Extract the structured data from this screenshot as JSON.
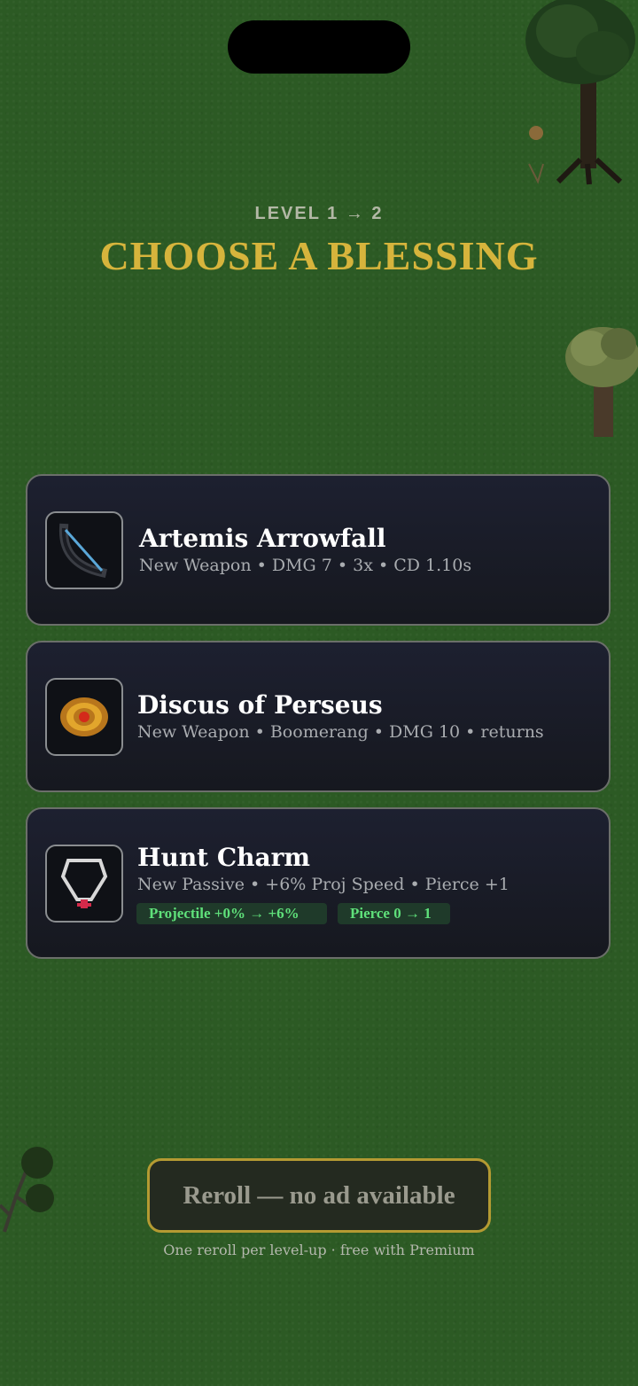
{
  "header": {
    "level_label": "LEVEL 1 → 2",
    "title": "CHOOSE A BLESSING"
  },
  "blessings": [
    {
      "icon": "bow-icon",
      "title": "Artemis Arrowfall",
      "description": "New Weapon • DMG 7 • 3x • CD 1.10s"
    },
    {
      "icon": "discus-icon",
      "title": "Discus of Perseus",
      "description": "New Weapon • Boomerang • DMG 10 • returns"
    },
    {
      "icon": "charm-necklace-icon",
      "title": "Hunt Charm",
      "description": "New Passive • +6% Proj Speed • Pierce +1",
      "chips": [
        "Projectile +0% → +6%",
        "Pierce 0 → 1"
      ]
    }
  ],
  "reroll": {
    "button_label": "Reroll — no ad available",
    "note": "One reroll per level-up · free with Premium"
  },
  "colors": {
    "background": "#2c5a24",
    "title_gold": "#d6b43c",
    "chip_green": "#5fe07a",
    "button_border": "#b49a32"
  }
}
